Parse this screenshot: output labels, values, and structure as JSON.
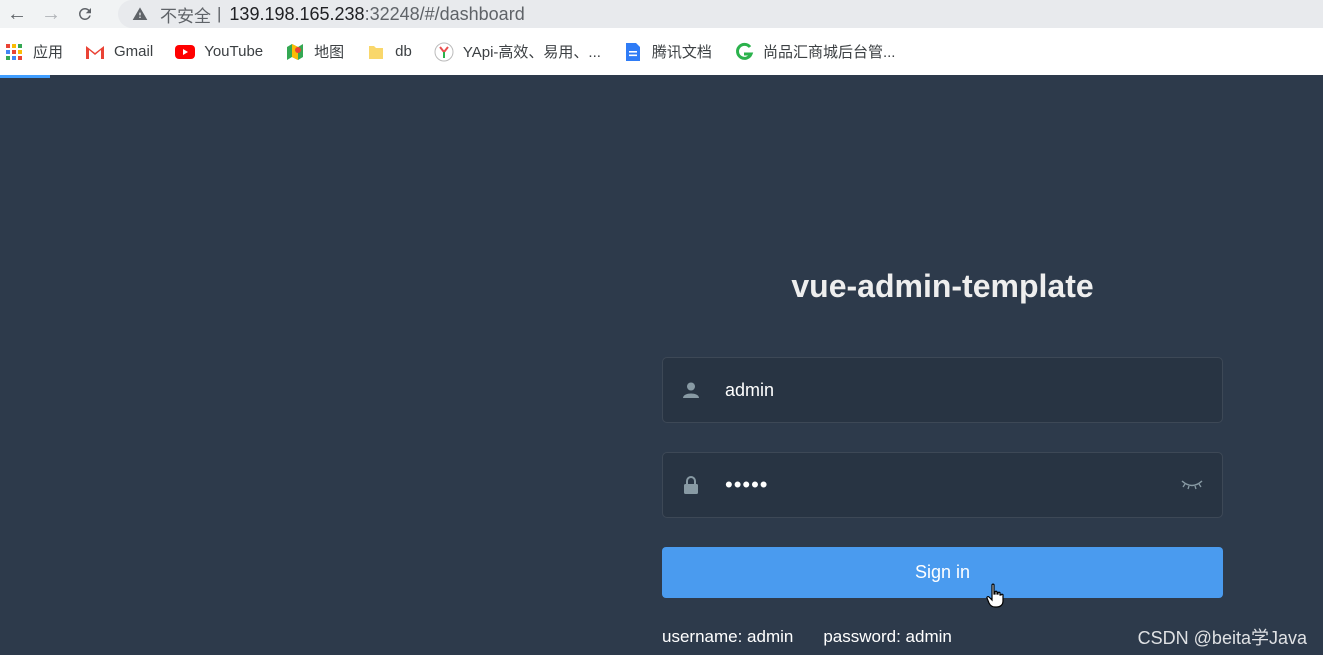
{
  "browser": {
    "not_secure": "不安全",
    "separator": "|",
    "url_host": "139.198.165.238",
    "url_rest": ":32248/#/dashboard",
    "nav_icons": [
      "back-icon",
      "forward-icon",
      "reload-icon"
    ]
  },
  "bookmarks": [
    {
      "label": "应用",
      "icon": "apps-grid-icon"
    },
    {
      "label": "Gmail",
      "icon": "gmail-icon"
    },
    {
      "label": "YouTube",
      "icon": "youtube-icon"
    },
    {
      "label": "地图",
      "icon": "maps-icon"
    },
    {
      "label": "db",
      "icon": "folder-icon"
    },
    {
      "label": "YApi-高效、易用、...",
      "icon": "yapi-icon"
    },
    {
      "label": "腾讯文档",
      "icon": "docs-icon"
    },
    {
      "label": "尚品汇商城后台管...",
      "icon": "green-g-icon"
    }
  ],
  "login": {
    "title": "vue-admin-template",
    "username_value": "admin",
    "password_mask": "•••••",
    "signin_label": "Sign in",
    "tip_username": "username: admin",
    "tip_password": "password: admin"
  },
  "watermark": "CSDN @beita学Java",
  "colors": {
    "page_bg": "#2d3a4b",
    "field_bg": "#283443",
    "button_bg": "#4a9bef",
    "title": "#eeeeee"
  }
}
